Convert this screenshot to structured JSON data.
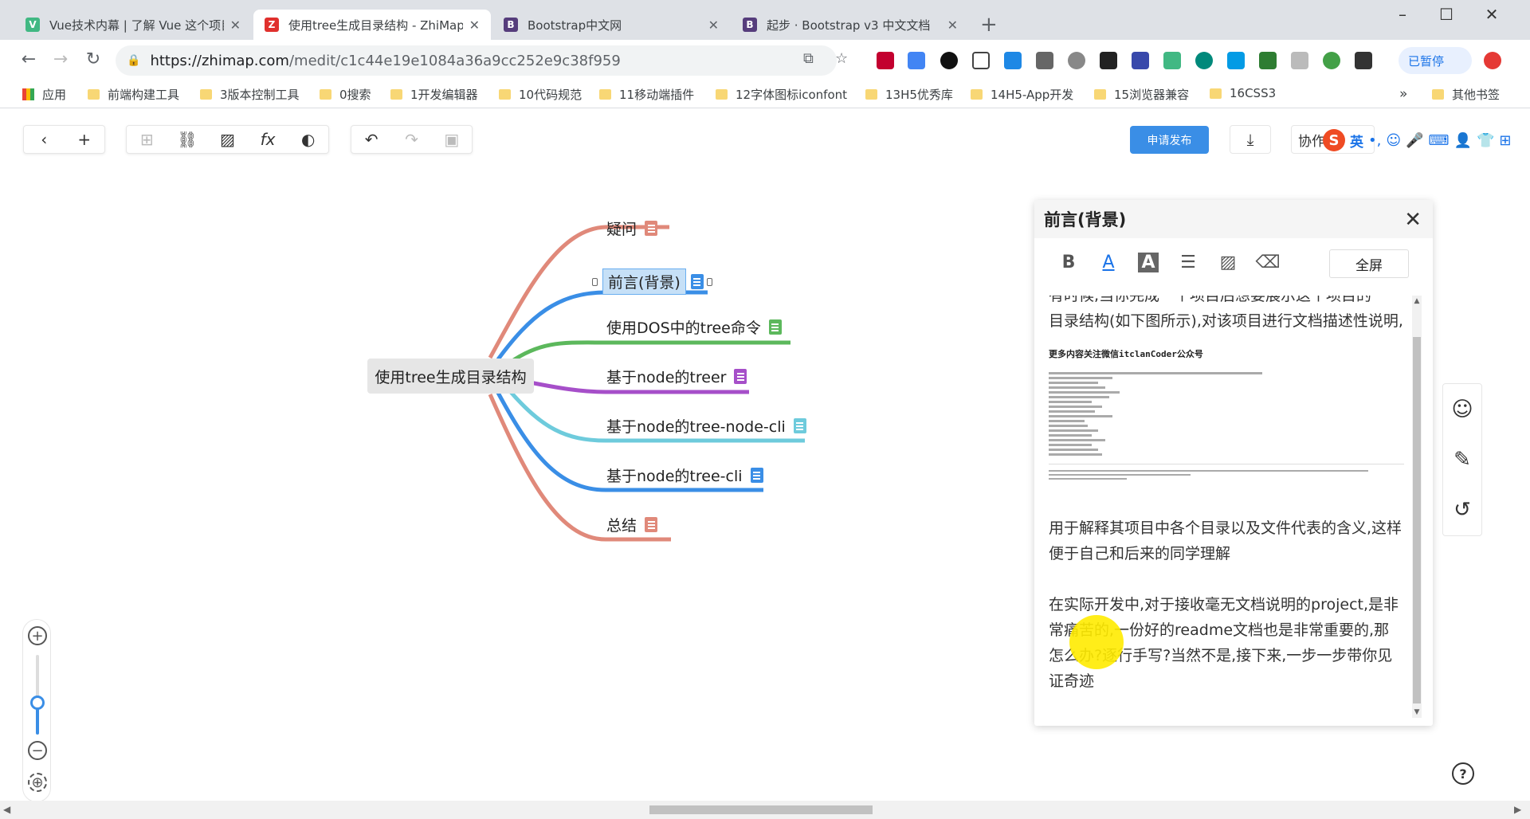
{
  "browser": {
    "tabs": [
      {
        "title": "Vue技术内幕 | 了解 Vue 这个项目",
        "fav": "V",
        "fav_color": "#41b883"
      },
      {
        "title": "使用tree生成目录结构 - ZhiMap",
        "fav": "Z",
        "fav_color": "#e0302d"
      },
      {
        "title": "Bootstrap中文网",
        "fav": "B",
        "fav_color": "#563d7c"
      },
      {
        "title": "起步 · Bootstrap v3 中文文档",
        "fav": "B",
        "fav_color": "#563d7c"
      }
    ],
    "url_main": "https://zhimap.com",
    "url_path": "/medit/c1c44e19e1084a36a9cc252e9c38f959",
    "paused_label": "已暂停",
    "bookmarks": [
      "应用",
      "前端构建工具",
      "3版本控制工具",
      "0搜索",
      "1开发编辑器",
      "10代码规范",
      "11移动端插件",
      "12字体图标iconfont",
      "13H5优秀库",
      "14H5-App开发",
      "15浏览器兼容",
      "16CSS3"
    ],
    "other_bookmarks": "其他书签",
    "bookmarks_more": "»"
  },
  "app": {
    "publish_label": "申请发布",
    "collab_label": "协作",
    "ime_label": "英"
  },
  "mindmap": {
    "root": "使用tree生成目录结构",
    "nodes": [
      {
        "label": "疑问",
        "color": "#e0897a"
      },
      {
        "label": "前言(背景)",
        "color": "#3a8ee6"
      },
      {
        "label": "使用DOS中的tree命令",
        "color": "#5cb85c"
      },
      {
        "label": "基于node的treer",
        "color": "#a64fc9"
      },
      {
        "label": "基于node的tree-node-cli",
        "color": "#6ecbdc"
      },
      {
        "label": "基于node的tree-cli",
        "color": "#3a8ee6"
      },
      {
        "label": "总结",
        "color": "#e0897a"
      }
    ]
  },
  "panel": {
    "title": "前言(背景)",
    "fullscreen_label": "全屏",
    "para_top_cut": "有时候,当你完成一个项目后想要展示这个项目的",
    "para1": "目录结构(如下图所示),对该项目进行文档描述性说明,",
    "image_caption": "更多内容关注微信itclanCoder公众号",
    "para2": "用于解释其项目中各个目录以及文件代表的含义,这样便于自己和后来的同学理解",
    "para3": "在实际开发中,对于接收毫无文档说明的project,是非常痛苦的,一份好的readme文档也是非常重要的,那怎么办?逐行手写?当然不是,接下来,一步一步带你见证奇迹"
  },
  "zoom": {
    "level": 0.4
  }
}
